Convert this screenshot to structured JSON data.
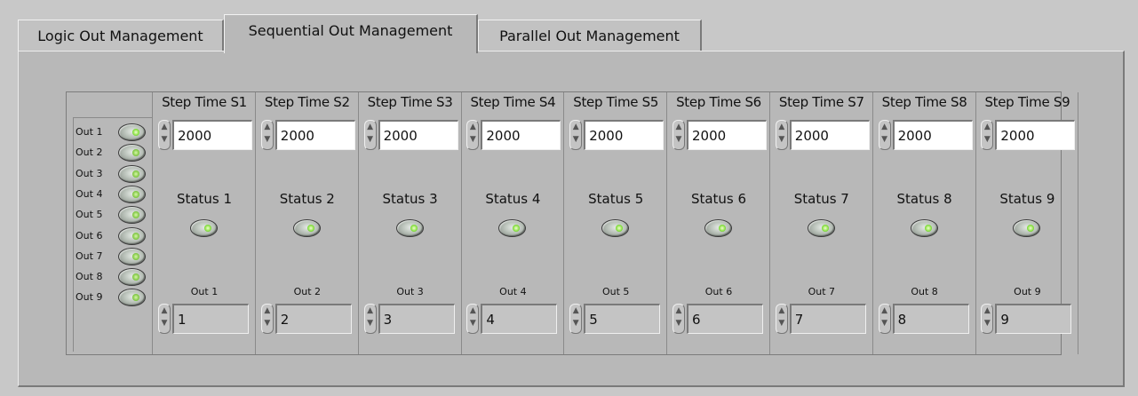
{
  "tabs": [
    {
      "label": "Logic Out Management",
      "active": false
    },
    {
      "label": "Sequential Out Management",
      "active": true
    },
    {
      "label": "Parallel Out Management",
      "active": false
    }
  ],
  "left_outputs": [
    {
      "label": "Out 1",
      "led_on": true
    },
    {
      "label": "Out 2",
      "led_on": false
    },
    {
      "label": "Out 3",
      "led_on": false
    },
    {
      "label": "Out 4",
      "led_on": false
    },
    {
      "label": "Out 5",
      "led_on": false
    },
    {
      "label": "Out 6",
      "led_on": false
    },
    {
      "label": "Out 7",
      "led_on": false
    },
    {
      "label": "Out 8",
      "led_on": false
    },
    {
      "label": "Out 9",
      "led_on": false
    }
  ],
  "steps": [
    {
      "header": "Step Time S1",
      "step_time": "2000",
      "status_label": "Status 1",
      "out_label": "Out 1",
      "out_value": "1"
    },
    {
      "header": "Step Time S2",
      "step_time": "2000",
      "status_label": "Status 2",
      "out_label": "Out 2",
      "out_value": "2"
    },
    {
      "header": "Step Time S3",
      "step_time": "2000",
      "status_label": "Status 3",
      "out_label": "Out 3",
      "out_value": "3"
    },
    {
      "header": "Step Time S4",
      "step_time": "2000",
      "status_label": "Status 4",
      "out_label": "Out 4",
      "out_value": "4"
    },
    {
      "header": "Step Time S5",
      "step_time": "2000",
      "status_label": "Status 5",
      "out_label": "Out 5",
      "out_value": "5"
    },
    {
      "header": "Step Time S6",
      "step_time": "2000",
      "status_label": "Status 6",
      "out_label": "Out 6",
      "out_value": "6"
    },
    {
      "header": "Step Time S7",
      "step_time": "2000",
      "status_label": "Status 7",
      "out_label": "Out 7",
      "out_value": "7"
    },
    {
      "header": "Step Time S8",
      "step_time": "2000",
      "status_label": "Status 8",
      "out_label": "Out 8",
      "out_value": "8"
    },
    {
      "header": "Step Time S9",
      "step_time": "2000",
      "status_label": "Status 9",
      "out_label": "Out 9",
      "out_value": "9"
    }
  ],
  "icons": {
    "spin_up": "▲",
    "spin_down": "▼"
  }
}
